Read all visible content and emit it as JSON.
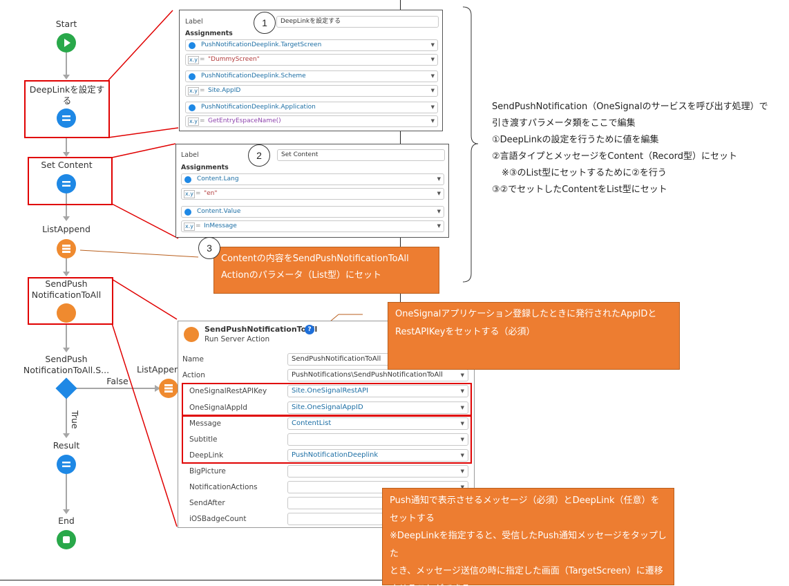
{
  "flow": {
    "start_label": "Start",
    "node1_label": "DeepLinkを設定する",
    "node2_label": "Set Content",
    "node3_label": "ListAppend",
    "node4_label": "SendPush NotificationToAll",
    "node5_label": "SendPush NotificationToAll.S...",
    "false_label": "False",
    "true_label": "True",
    "listappend_side_label": "ListAppend",
    "result_label": "Result",
    "end_label": "End"
  },
  "panel1": {
    "number": "1",
    "label_caption": "Label",
    "label_value": "DeepLinkを設定する",
    "assignments_title": "Assignments",
    "rows": [
      {
        "var": "PushNotificationDeeplink.TargetScreen",
        "value": "\"DummyScreen\""
      },
      {
        "var": "PushNotificationDeeplink.Scheme",
        "value": "Site.AppID"
      },
      {
        "var": "PushNotificationDeeplink.Application",
        "value": "GetEntryEspaceName()"
      }
    ]
  },
  "panel2": {
    "number": "2",
    "label_caption": "Label",
    "label_value": "Set Content",
    "assignments_title": "Assignments",
    "rows": [
      {
        "var": "Content.Lang",
        "value": "\"en\""
      },
      {
        "var": "Content.Value",
        "value": "InMessage"
      }
    ]
  },
  "callout3": {
    "number": "3",
    "line1": "Contentの内容をSendPushNotificationToAll",
    "line2": "Actionのパラメータ（List型）にセット"
  },
  "note": {
    "line1": "SendPushNotification（OneSignalのサービスを呼び出す処理）で",
    "line2": "引き渡すパラメータ類をここで編集",
    "line3": "①DeepLinkの設定を行うために値を編集",
    "line4": "②言語タイプとメッセージをContent（Record型）にセット",
    "line5": "※③のList型にセットするために②を行う",
    "line6": "③②でセットしたContentをList型にセット"
  },
  "callout_appid": {
    "line1": "OneSignalアプリケーション登録したときに発行されたAppIDと",
    "line2": "RestAPIKeyをセットする（必須）"
  },
  "callout_push": {
    "line1": "Push通知で表示させるメッセージ（必須）とDeepLink（任意）を",
    "line2": "セットする",
    "line3": "※DeepLinkを指定すると、受信したPush通知メッセージをタップした",
    "line4": "とき、メッセージ送信の時に指定した画面（TargetScreen）に遷移",
    "line5": "させることができる"
  },
  "server_panel": {
    "title": "SendPushNotificationToAll",
    "subtitle": "Run Server Action",
    "help": "?",
    "rows": [
      {
        "label": "Name",
        "value": ""
      },
      {
        "label": "Action",
        "value": "PushNotifications\\SendPushNotificationToAll"
      },
      {
        "label": "OneSignalRestAPIKey",
        "value": "Site.OneSignalRestAPI"
      },
      {
        "label": "OneSignalAppId",
        "value": "Site.OneSignalAppID"
      },
      {
        "label": "Message",
        "value": "ContentList"
      },
      {
        "label": "Subtitle",
        "value": ""
      },
      {
        "label": "DeepLink",
        "value": "PushNotificationDeeplink"
      },
      {
        "label": "BigPicture",
        "value": ""
      },
      {
        "label": "NotificationActions",
        "value": ""
      },
      {
        "label": "SendAfter",
        "value": ""
      },
      {
        "label": "iOSBadgeCount",
        "value": ""
      }
    ],
    "name_value": "SendPushNotificationToAll"
  },
  "colors": {
    "flow_blue": "#1e88e5",
    "flow_green": "#29a84a",
    "flow_orange": "#ef8a2f",
    "highlight_red": "#e00000",
    "callout_orange": "#ed7d31"
  }
}
